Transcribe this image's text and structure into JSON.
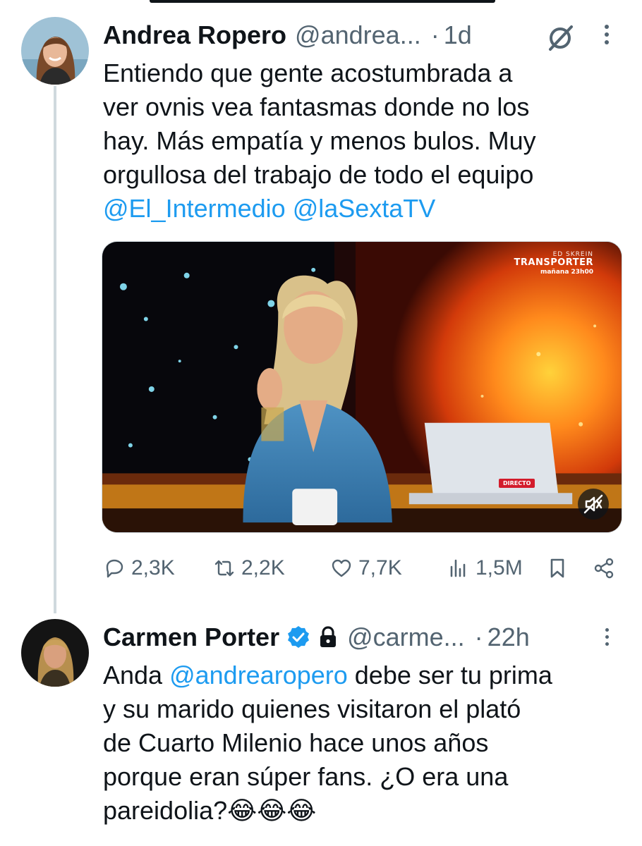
{
  "tweet1": {
    "author_name": "Andrea Ropero",
    "handle": "@andrea...",
    "separator": "·",
    "time": "1d",
    "text_lines": [
      "Entiendo que gente acostumbrada a",
      "ver ovnis vea fantasmas donde no los",
      "hay. Más empatía y menos bulos. Muy",
      "orgullosa del trabajo de todo el equipo"
    ],
    "mentions": [
      "@El_Intermedio",
      "@laSextaTV"
    ],
    "media": {
      "promo_line1": "ED SKREIN",
      "promo_line2": "TRANSPORTER",
      "promo_line3": "mañana 23h00",
      "live_badge": "DIRECTO",
      "muted": true
    },
    "stats": {
      "replies": "2,3K",
      "reposts": "2,2K",
      "likes": "7,7K",
      "views": "1,5M"
    },
    "icons": [
      "grok-icon",
      "more-icon",
      "reply-icon",
      "repost-icon",
      "like-icon",
      "views-icon",
      "bookmark-icon",
      "share-icon",
      "mute-icon"
    ]
  },
  "tweet2": {
    "author_name": "Carmen Porter",
    "verified": true,
    "protected": true,
    "handle": "@carme...",
    "separator": "·",
    "time": "22h",
    "text_line1_prefix": "Anda ",
    "text_line1_mention": "@andrearopero",
    "text_line1_suffix": " debe ser tu prima",
    "text_lines": [
      "y su marido quienes visitaron el plató",
      "de Cuarto Milenio hace unos años",
      "porque eran súper fans. ¿O era una"
    ],
    "text_last": "pareidolia?",
    "emoji": "😂😂😂"
  },
  "colors": {
    "text": "#0f1419",
    "secondary": "#536471",
    "link": "#1d9bf0",
    "thread_line": "#cfd9de"
  }
}
